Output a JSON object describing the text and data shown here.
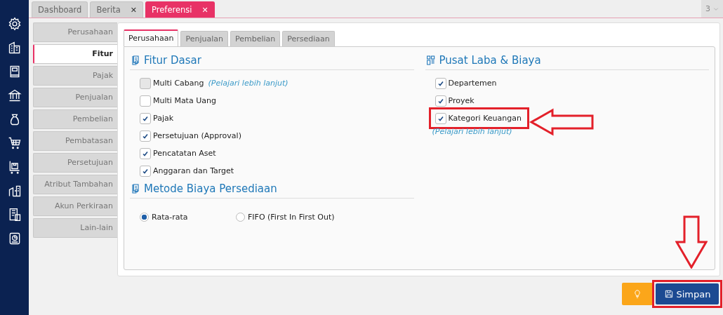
{
  "top_tabs": [
    {
      "label": "Dashboard",
      "selected": false,
      "closable": false
    },
    {
      "label": "Berita",
      "selected": false,
      "closable": true,
      "close": "✕"
    },
    {
      "label": "Preferensi",
      "selected": true,
      "closable": true,
      "close": "✕"
    }
  ],
  "tab_count": "3",
  "menu": [
    {
      "label": "Perusahaan",
      "selected": false
    },
    {
      "label": "Fitur",
      "selected": true
    },
    {
      "label": "Pajak",
      "selected": false
    },
    {
      "label": "Penjualan",
      "selected": false
    },
    {
      "label": "Pembelian",
      "selected": false
    },
    {
      "label": "Pembatasan",
      "selected": false
    },
    {
      "label": "Persetujuan",
      "selected": false
    },
    {
      "label": "Atribut Tambahan",
      "selected": false
    },
    {
      "label": "Akun Perkiraan",
      "selected": false
    },
    {
      "label": "Lain-lain",
      "selected": false
    }
  ],
  "inner_tabs": [
    {
      "label": "Perusahaan",
      "selected": true
    },
    {
      "label": "Penjualan",
      "selected": false
    },
    {
      "label": "Pembelian",
      "selected": false
    },
    {
      "label": "Persediaan",
      "selected": false
    }
  ],
  "fitur_dasar": {
    "title": "Fitur Dasar",
    "items": [
      {
        "label": "Multi Cabang",
        "checked": false,
        "disabled": true,
        "link": "(Pelajari lebih lanjut)"
      },
      {
        "label": "Multi Mata Uang",
        "checked": false,
        "disabled": false
      },
      {
        "label": "Pajak",
        "checked": true,
        "disabled": false
      },
      {
        "label": "Persetujuan (Approval)",
        "checked": true,
        "disabled": false
      },
      {
        "label": "Pencatatan Aset",
        "checked": true,
        "disabled": false
      },
      {
        "label": "Anggaran dan Target",
        "checked": true,
        "disabled": false
      }
    ]
  },
  "metode_biaya": {
    "title": "Metode Biaya Persediaan",
    "options": [
      {
        "label": "Rata-rata",
        "selected": true
      },
      {
        "label": "FIFO (First In First Out)",
        "selected": false
      }
    ]
  },
  "pusat_laba": {
    "title": "Pusat Laba & Biaya",
    "items": [
      {
        "label": "Departemen",
        "checked": true,
        "highlighted": false
      },
      {
        "label": "Proyek",
        "checked": true,
        "highlighted": false
      },
      {
        "label": "Kategori Keuangan",
        "checked": true,
        "highlighted": true
      }
    ],
    "link": "(Pelajari lebih lanjut)"
  },
  "buttons": [
    {
      "kind": "hint"
    },
    {
      "kind": "save",
      "label": "Simpan",
      "highlighted": true
    }
  ]
}
